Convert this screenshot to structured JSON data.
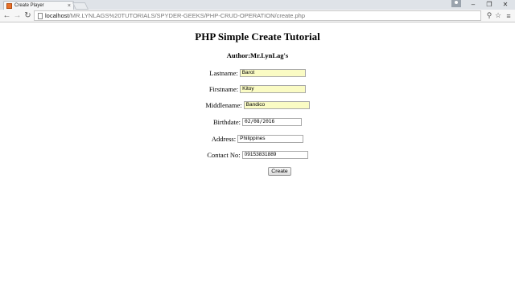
{
  "browser": {
    "tab_title": "Create Player",
    "tab_close": "×",
    "window_controls": {
      "minimize": "‒",
      "restore": "❐",
      "close": "✕"
    },
    "nav": {
      "back": "←",
      "forward": "→",
      "reload": "↻"
    },
    "url_host": "localhost",
    "url_path": "/MR.LYNLAGS%20TUTORIALS/SPYDER-GEEKS/PHP-CRUD-OPERATION/create.php",
    "zoom_glyph": "⚲",
    "bookmark_glyph": "☆",
    "menu_glyph": "≡"
  },
  "page": {
    "heading": "PHP Simple Create Tutorial",
    "author": "Author:Mr.LynLag's",
    "form": {
      "fields": [
        {
          "label": "Lastname:",
          "value": "Barot"
        },
        {
          "label": "Firstname:",
          "value": "Kitoy"
        },
        {
          "label": "Middlename:",
          "value": "Bandico"
        },
        {
          "label": "Birthdate:",
          "value": "02/08/2016"
        },
        {
          "label": "Address:",
          "value": "Philippines"
        },
        {
          "label": "Contact No:",
          "value": "09153831889"
        }
      ],
      "submit_label": "Create"
    }
  }
}
